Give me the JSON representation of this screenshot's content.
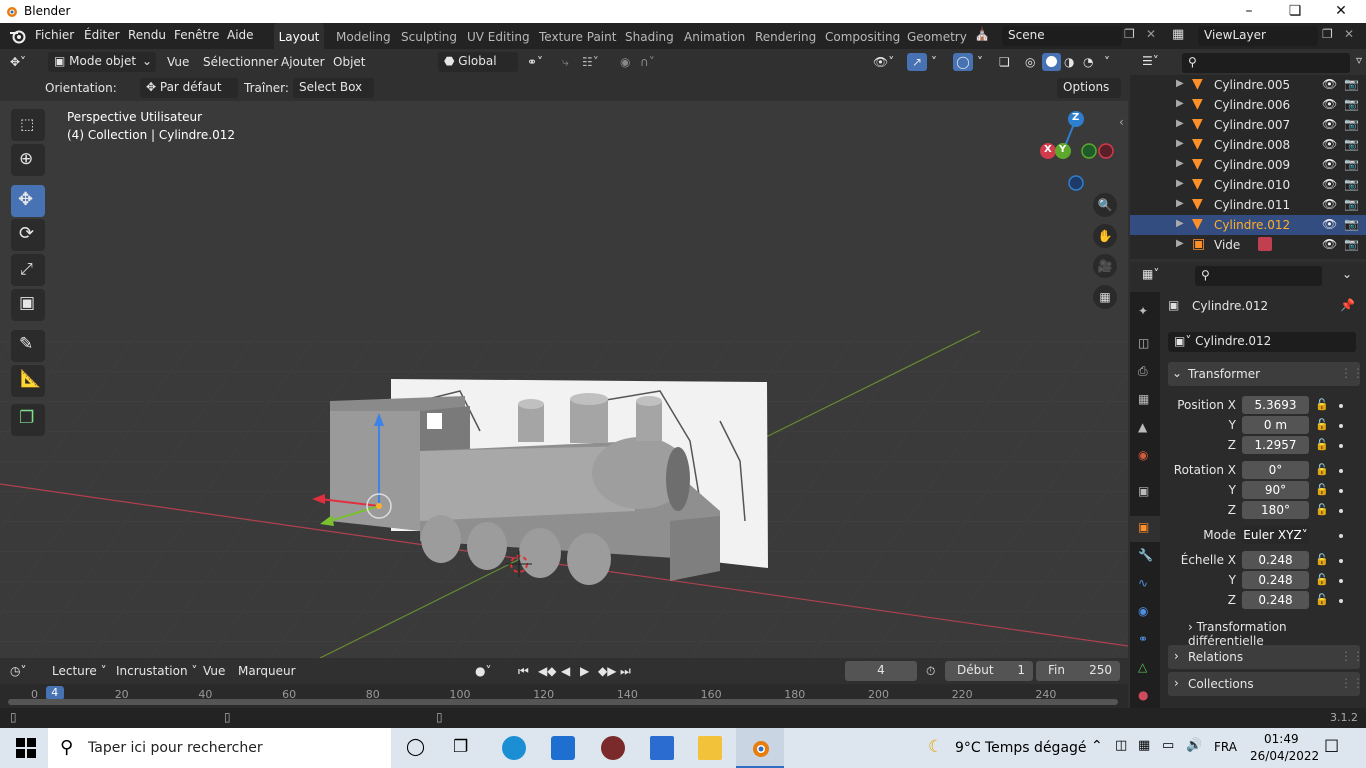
{
  "window": {
    "title": "Blender"
  },
  "menus": [
    "Fichier",
    "Éditer",
    "Rendu",
    "Fenêtre",
    "Aide"
  ],
  "workspaces": [
    "Layout",
    "Modeling",
    "Sculpting",
    "UV Editing",
    "Texture Paint",
    "Shading",
    "Animation",
    "Rendering",
    "Compositing",
    "Geometry"
  ],
  "scene": {
    "name": "Scene",
    "view_layer": "ViewLayer"
  },
  "viewport_header": {
    "mode": "Mode objet",
    "menus": [
      "Vue",
      "Sélectionner",
      "Ajouter",
      "Objet"
    ],
    "orientation_global": "Global"
  },
  "tool_header": {
    "orientation_label": "Orientation:",
    "orientation_value": "Par défaut",
    "drag_label": "Traîner:",
    "drag_value": "Select Box",
    "options": "Options"
  },
  "viewport": {
    "view_name": "Perspective Utilisateur",
    "collection_info": "(4) Collection | Cylindre.012",
    "gizmo_axes": {
      "z": "Z",
      "y": "Y",
      "x": "X"
    }
  },
  "outliner": {
    "items": [
      {
        "name": "Cylindre.005",
        "selected": false
      },
      {
        "name": "Cylindre.006",
        "selected": false
      },
      {
        "name": "Cylindre.007",
        "selected": false
      },
      {
        "name": "Cylindre.008",
        "selected": false
      },
      {
        "name": "Cylindre.009",
        "selected": false
      },
      {
        "name": "Cylindre.010",
        "selected": false
      },
      {
        "name": "Cylindre.011",
        "selected": false
      },
      {
        "name": "Cylindre.012",
        "selected": true
      },
      {
        "name": "Vide",
        "selected": false
      }
    ]
  },
  "properties": {
    "object_name": "Cylindre.012",
    "object_field": "Cylindre.012",
    "transform_title": "Transformer",
    "position_label": "Position X",
    "y_label": "Y",
    "z_label": "Z",
    "position": {
      "x": "5.3693",
      "y": "0 m",
      "z": "1.2957"
    },
    "rotation_label": "Rotation X",
    "rotation": {
      "x": "0°",
      "y": "90°",
      "z": "180°"
    },
    "mode_label": "Mode",
    "mode_value": "Euler XYZ",
    "scale_label": "Échelle X",
    "scale": {
      "x": "0.248",
      "y": "0.248",
      "z": "0.248"
    },
    "delta_transform": "Transformation différentielle",
    "relations": "Relations",
    "collections": "Collections"
  },
  "timeline": {
    "playback": "Lecture",
    "keying": "Incrustation",
    "view": "Vue",
    "marker": "Marqueur",
    "current_frame": "4",
    "start_label": "Début",
    "start_value": "1",
    "end_label": "Fin",
    "end_value": "250",
    "ruler": [
      "0",
      "20",
      "40",
      "60",
      "80",
      "100",
      "120",
      "140",
      "160",
      "180",
      "200",
      "220",
      "240"
    ],
    "playhead": "4"
  },
  "status": {
    "version": "3.1.2"
  },
  "taskbar": {
    "search_placeholder": "Taper ici pour rechercher",
    "weather_temp": "9°C",
    "weather_desc": "Temps dégagé",
    "lang": "FRA",
    "time": "01:49",
    "date": "26/04/2022"
  },
  "colors": {
    "accent": "#4772b3",
    "selection": "#ffaf29",
    "x_axis": "#d23b4b",
    "y_axis": "#5ea82b",
    "z_axis": "#2f7fd0"
  }
}
